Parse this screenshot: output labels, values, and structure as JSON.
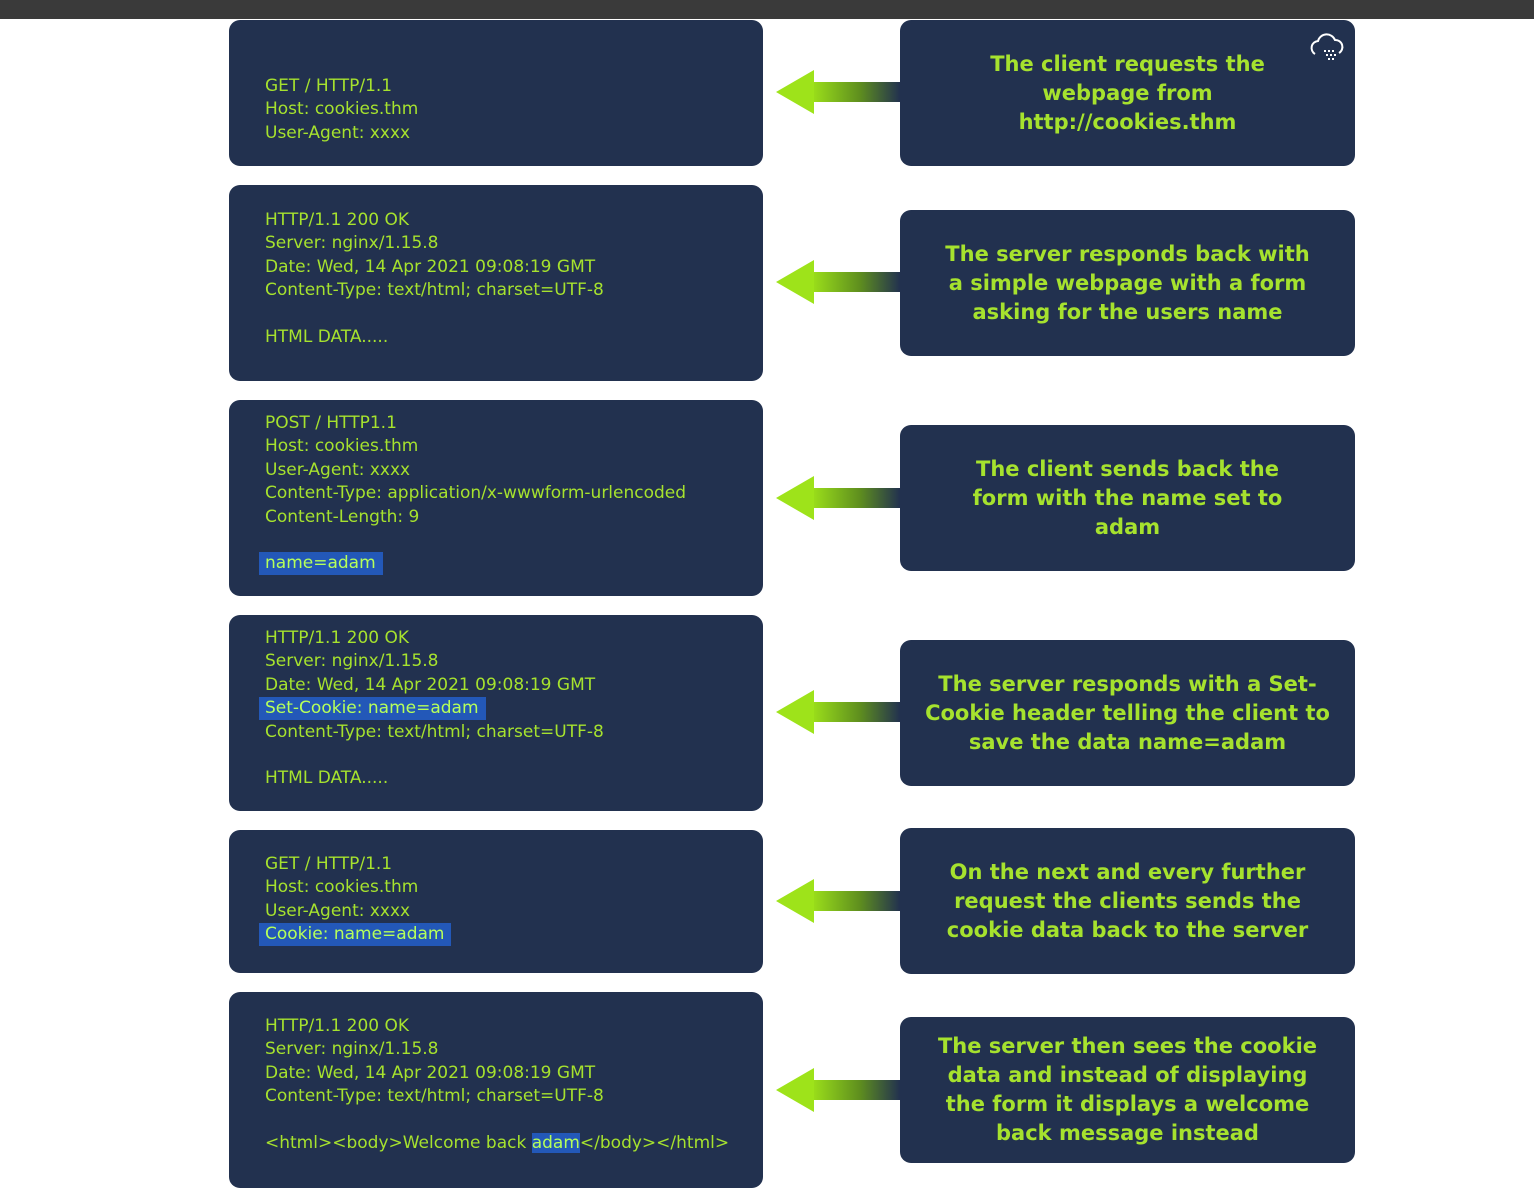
{
  "steps": [
    {
      "message": [
        "GET / HTTP/1.1",
        "Host: cookies.thm",
        "User-Agent: xxxx"
      ],
      "description": "The client requests the webpage from http://cookies.thm"
    },
    {
      "message": [
        "HTTP/1.1 200 OK",
        "Server: nginx/1.15.8",
        "Date: Wed, 14 Apr 2021 09:08:19 GMT",
        "Content-Type: text/html; charset=UTF-8",
        "",
        "HTML DATA....."
      ],
      "description": "The server responds back with a simple webpage with a form asking for the users name"
    },
    {
      "message": [
        "POST / HTTP1.1",
        "Host: cookies.thm",
        "User-Agent: xxxx",
        "Content-Type: application/x-wwwform-urlencoded",
        "Content-Length: 9",
        "",
        "name=adam"
      ],
      "highlight": "name=adam",
      "description": "The client sends back the form with the name set to adam"
    },
    {
      "message": [
        "HTTP/1.1 200 OK",
        "Server: nginx/1.15.8",
        "Date: Wed, 14 Apr 2021 09:08:19 GMT",
        "Set-Cookie: name=adam",
        "Content-Type: text/html; charset=UTF-8",
        "",
        "HTML DATA....."
      ],
      "highlight": "Set-Cookie: name=adam",
      "description": "The server responds with a Set-Cookie header telling the client to save the data name=adam"
    },
    {
      "message": [
        "GET / HTTP/1.1",
        "Host: cookies.thm",
        "User-Agent: xxxx",
        "Cookie: name=adam"
      ],
      "highlight": "Cookie: name=adam",
      "description": "On the next and every further request the clients sends the cookie data back to the server"
    },
    {
      "message": [
        "HTTP/1.1 200 OK",
        "Server: nginx/1.15.8",
        "Date: Wed, 14 Apr 2021 09:08:19 GMT",
        "Content-Type: text/html; charset=UTF-8",
        "",
        "<html><body>Welcome back adam</body></html>"
      ],
      "highlight": "adam",
      "description": "The server then sees the cookie data and instead of displaying the form it displays a welcome back message instead"
    }
  ],
  "colors": {
    "card": "#22314f",
    "text": "#a6e22e",
    "highlight": "#2358b8",
    "arrow": "#9ee31a",
    "topbar": "#3a3a3a"
  },
  "icons": [
    "cloud-icon"
  ]
}
